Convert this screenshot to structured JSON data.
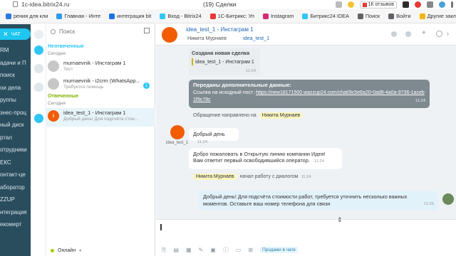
{
  "browser": {
    "address": "1c-idea.bitrix24.ru",
    "window_title": "(19) Сделки",
    "reviews_label": "1К отзывов",
    "bookmarks": [
      {
        "label": "рения для кли",
        "color": "#2b7bde"
      },
      {
        "label": "Главная - Инте",
        "color": "#2c9ae8"
      },
      {
        "label": "интеграция bit",
        "color": "#1a73e8"
      },
      {
        "label": "Вход - Bitrix24",
        "color": "#2fc6f6"
      },
      {
        "label": "1С-Битрикс: Уп",
        "color": "#e53935"
      },
      {
        "label": "Instagram",
        "color": "#d62976"
      },
      {
        "label": "Битрикс24 IDEA",
        "color": "#2fc6f6"
      },
      {
        "label": "Поиск",
        "color": "#5f6368"
      },
      {
        "label": "Войти",
        "color": "#5f6368"
      },
      {
        "label": "Другие закладки",
        "color": "#f4b400"
      }
    ]
  },
  "left_nav": {
    "chat_button": "ЧАТ",
    "items": [
      "RM",
      "адачи и П",
      "поиск",
      "ои дела",
      "руппы",
      "знес-проц",
      "ный диск",
      "ртал",
      "отрудники",
      "ЕКС",
      "онтакт-це",
      "аборатор",
      "ZZUP",
      "нтеграция",
      "екомерт"
    ]
  },
  "list": {
    "search_placeholder": "Поиск",
    "unanswered_label": "Неотвеченные",
    "today_label_1": "Сегодня",
    "answered_label": "Отвеченные",
    "today_label_2": "Сегодня",
    "items": [
      {
        "name": "murnaevnik - Инстаграм 1",
        "sub": "Тест",
        "badge": ""
      },
      {
        "name": "murnaevnik - i2crm (WhatsApp...",
        "sub": "Требуется помощь",
        "badge": "1"
      },
      {
        "name": "idea_test_1 - Инстаграм 1",
        "sub": "Добрый день! Для подсчёта стои...",
        "badge": ""
      }
    ],
    "status": "Онлайн"
  },
  "chat": {
    "title": "idea_test_1 - Инстаграм 1",
    "members": [
      "Никита Мурнаев",
      "idea_test_1"
    ],
    "deal_created": "Создана новая сделка",
    "deal_name": "idea_test_1 - Инстаграм 1",
    "deal_time": "11:24",
    "extra_title": "Переданы дополнительные данные:",
    "extra_link_prefix": "Ссылка на исходный пост:",
    "extra_link": "https://new18171500.wazzup24.com/chat/9c5e8a20-0ad8-4a0a-9736-1aceb1f9c78c",
    "extra_time": "11:24",
    "routed_text": "Обращение направлено на",
    "routed_name": "Никита Мурнаев",
    "client_name": "idea_test_1",
    "client_msg": "Добрый день",
    "client_time": "11:24",
    "welcome_line1": "Добро пожаловать в Открытую линию компании Идея!",
    "welcome_line2": "Вам ответит первый освободившийся оператор.",
    "welcome_time": "11:24",
    "start_name": "Никита Мурнаев",
    "start_text": "начал работу с диалогом",
    "start_time": "11:24",
    "op_msg": "Добрый день! Для подсчёта стоимости работ, требуется уточнить несколько важных моментов. Оставьте ваш номер телефона для связи",
    "op_time": "11:25",
    "sales_label": "Продажи в чате"
  }
}
